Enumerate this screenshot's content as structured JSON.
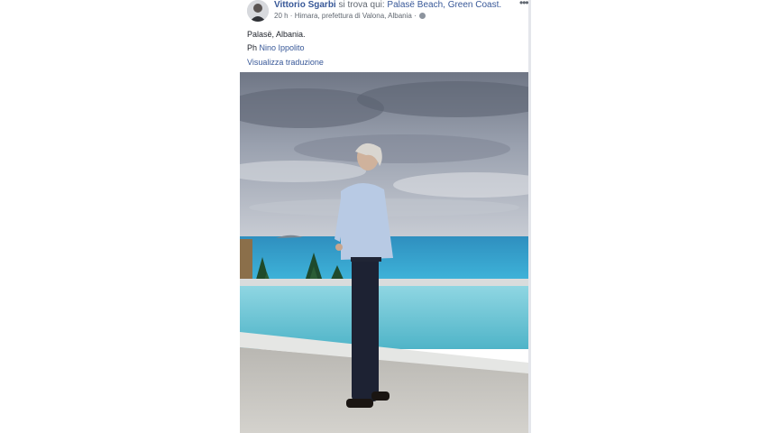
{
  "post": {
    "author": "Vittorio Sgarbi",
    "checkin_text": " si trova qui: ",
    "place": "Palasë Beach, Green Coast.",
    "time": "20 h",
    "separator": " · ",
    "location": "Himara, prefettura di Valona, Albania",
    "separator2": " · ",
    "caption": "Palasë, Albania.",
    "credit_prefix": "Ph ",
    "credit_tag": "Nino Ippolito",
    "translate_label": "Visualizza traduzione",
    "privacy_icon": "globe-icon",
    "menu_icon": "more-icon",
    "menu_glyph": "•••"
  },
  "colors": {
    "link": "#385898",
    "meta": "#606770",
    "text": "#1d2129",
    "sea": "#3fb2d6",
    "sky": "#8f97a6"
  }
}
